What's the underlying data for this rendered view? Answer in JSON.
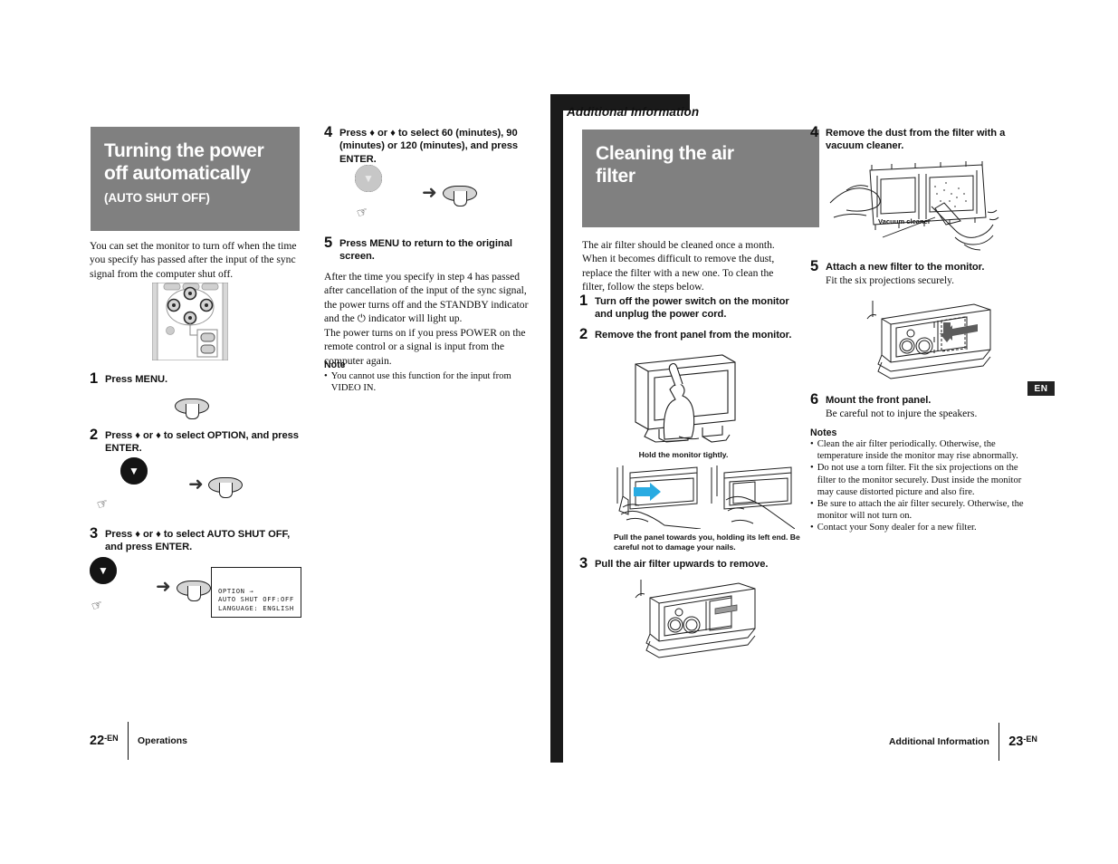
{
  "left_page": {
    "title_lines": [
      "Turning the power",
      "off automatically"
    ],
    "subtitle": "(AUTO SHUT OFF)",
    "intro": "You can set the monitor to turn off when the time you specify has passed after the input of the sync signal from the computer shut off.",
    "steps": [
      {
        "num": "1",
        "text": "Press MENU."
      },
      {
        "num": "2",
        "text": "Press ♦ or ♦ to select OPTION, and press ENTER."
      },
      {
        "num": "3",
        "text": "Press ♦ or ♦ to select AUTO SHUT OFF, and press ENTER."
      },
      {
        "num": "4",
        "text": "Press ♦ or ♦ to select 60 (minutes), 90 (minutes) or 120 (minutes), and press ENTER."
      },
      {
        "num": "5",
        "text": "Press MENU to return to the original screen."
      }
    ],
    "osd": {
      "line1": "OPTION  →",
      "line2": "AUTO SHUT OFF:OFF",
      "line3": "LANGUAGE: ENGLISH"
    },
    "after_para1": "After the time you specify in step 4 has passed after cancellation of the input of the sync signal, the power turns off and the STANDBY indicator and the ⏻ indicator will light up.",
    "after_para2": "The power turns on if you press POWER on the remote control or a signal is input from the computer again.",
    "note_head": "Note",
    "note_items": [
      "You cannot use this function for the input from VIDEO IN."
    ],
    "footer": {
      "page_number": "22",
      "page_suffix": "-EN",
      "section": "Operations"
    }
  },
  "right_page": {
    "chapter": "Additional Information",
    "title_lines": [
      "Cleaning the air",
      "filter"
    ],
    "intro": "The air filter should be cleaned once a month. When it becomes difficult to remove the dust, replace the filter with a new one. To clean the filter, follow the steps below.",
    "steps": [
      {
        "num": "1",
        "text": "Turn off the power switch on the monitor and unplug the power cord."
      },
      {
        "num": "2",
        "text": "Remove the front panel from the monitor."
      },
      {
        "num": "3",
        "text": "Pull the air filter upwards to remove."
      },
      {
        "num": "4",
        "text": "Remove the dust from the filter with a vacuum cleaner."
      },
      {
        "num": "5",
        "text": "Attach a new filter to the monitor.",
        "sub": "Fit the six projections securely."
      },
      {
        "num": "6",
        "text": "Mount the front panel.",
        "sub": "Be careful not to injure the speakers."
      }
    ],
    "captions": {
      "hold_monitor": "Hold the monitor tightly.",
      "pull_panel": "Pull the panel towards you, holding its left end. Be careful not to damage your nails.",
      "vacuum_cleaner": "Vacuum cleaner"
    },
    "notes_head": "Notes",
    "notes_items": [
      "Clean the air filter periodically. Otherwise, the temperature inside the monitor may rise abnormally.",
      "Do not use a torn filter. Fit the six projections on the filter to the monitor securely. Dust inside the monitor may cause distorted picture and also fire.",
      "Be sure to attach the air filter securely. Otherwise, the monitor will not turn on.",
      "Contact your Sony dealer for a new filter."
    ],
    "footer": {
      "page_number": "23",
      "page_suffix": "-EN",
      "section": "Additional Information"
    },
    "edge_tab": "EN"
  },
  "colors": {
    "title_block_bg": "#808080",
    "spine_black": "#1a1a1a",
    "arrow_highlight": "#29ABE2",
    "button_on": "#141414",
    "button_off": "#c7c7c7"
  }
}
